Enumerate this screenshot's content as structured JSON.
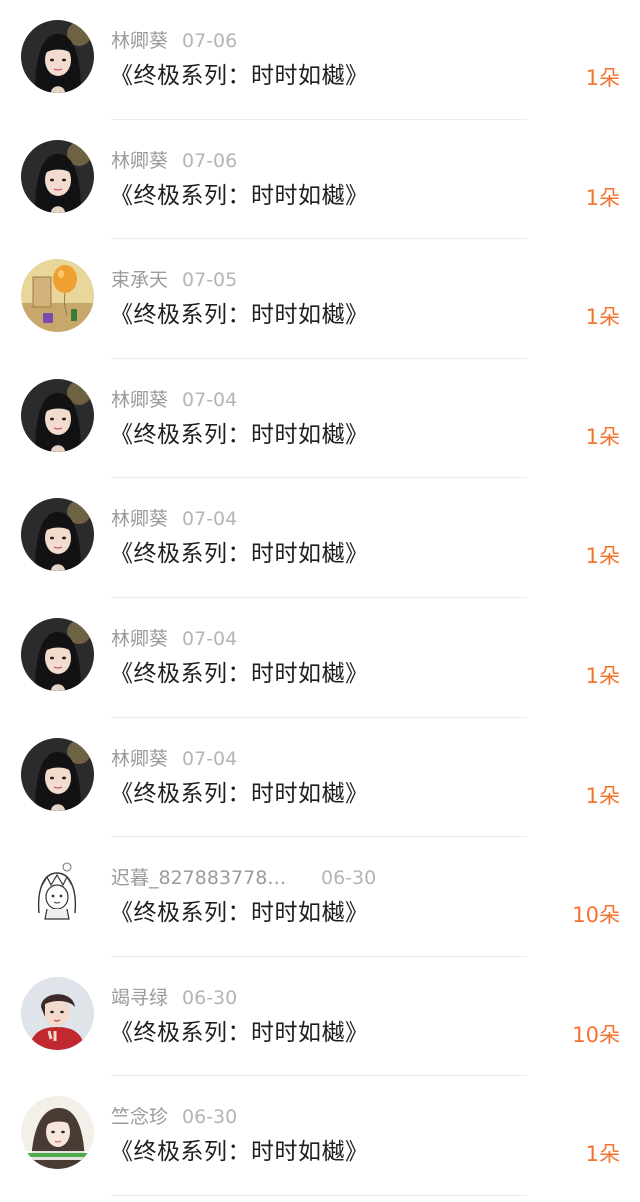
{
  "rows": [
    {
      "name": "林卿葵",
      "date": "07-06",
      "title": "《终极系列：时时如樾》",
      "count": "1朵",
      "avatar": "girl-dark-avatar"
    },
    {
      "name": "林卿葵",
      "date": "07-06",
      "title": "《终极系列：时时如樾》",
      "count": "1朵",
      "avatar": "girl-dark-avatar"
    },
    {
      "name": "束承天",
      "date": "07-05",
      "title": "《终极系列：时时如樾》",
      "count": "1朵",
      "avatar": "balloon-room-avatar"
    },
    {
      "name": "林卿葵",
      "date": "07-04",
      "title": "《终极系列：时时如樾》",
      "count": "1朵",
      "avatar": "girl-dark-avatar"
    },
    {
      "name": "林卿葵",
      "date": "07-04",
      "title": "《终极系列：时时如樾》",
      "count": "1朵",
      "avatar": "girl-dark-avatar"
    },
    {
      "name": "林卿葵",
      "date": "07-04",
      "title": "《终极系列：时时如樾》",
      "count": "1朵",
      "avatar": "girl-dark-avatar"
    },
    {
      "name": "林卿葵",
      "date": "07-04",
      "title": "《终极系列：时时如樾》",
      "count": "1朵",
      "avatar": "girl-dark-avatar"
    },
    {
      "name": "迟暮_827883778…",
      "date": "06-30",
      "title": "《终极系列：时时如樾》",
      "count": "10朵",
      "avatar": "sketch-girl-avatar"
    },
    {
      "name": "竭寻绿",
      "date": "06-30",
      "title": "《终极系列：时时如樾》",
      "count": "10朵",
      "avatar": "boy-red-avatar"
    },
    {
      "name": "竺念珍",
      "date": "06-30",
      "title": "《终极系列：时时如樾》",
      "count": "1朵",
      "avatar": "girl-light-avatar"
    }
  ],
  "colors": {
    "accent": "#f5732d",
    "name": "#9b9b9b",
    "date": "#b5b5b5",
    "title": "#1f1f1f",
    "divider": "#ececec"
  }
}
